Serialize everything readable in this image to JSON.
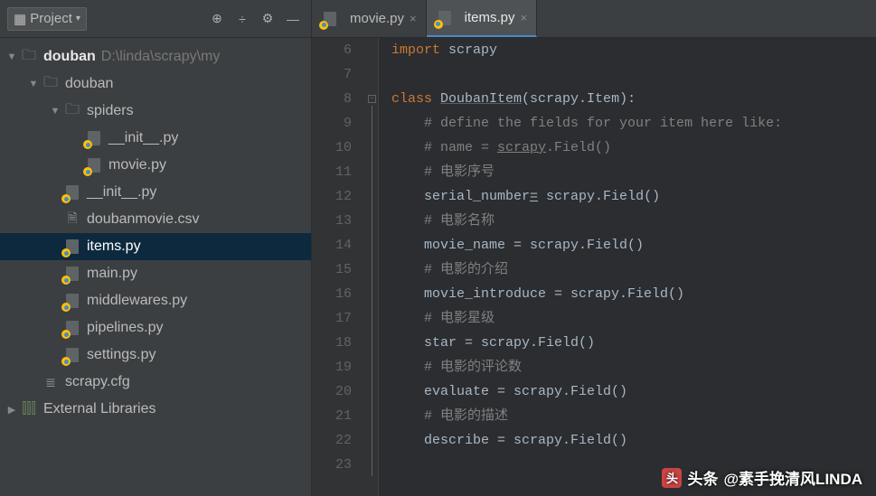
{
  "sidebar": {
    "projectButton": "Project",
    "tree": {
      "root": {
        "name": "douban",
        "path": "D:\\linda\\scrapy\\my"
      },
      "douban": "douban",
      "spiders": "spiders",
      "init1": "__init__.py",
      "movie": "movie.py",
      "init2": "__init__.py",
      "csv": "doubanmovie.csv",
      "items": "items.py",
      "main": "main.py",
      "middlewares": "middlewares.py",
      "pipelines": "pipelines.py",
      "settings": "settings.py",
      "cfg": "scrapy.cfg",
      "ext": "External Libraries"
    }
  },
  "tabs": [
    {
      "label": "movie.py",
      "active": false
    },
    {
      "label": "items.py",
      "active": true
    }
  ],
  "editor": {
    "startLine": 6,
    "lines": [
      {
        "n": 6,
        "html": "<span class='kw'>import</span> scrapy"
      },
      {
        "n": 7,
        "html": ""
      },
      {
        "n": 8,
        "html": "<span class='kw'>class</span> <span class='cls'>DoubanItem</span>(scrapy.Item):"
      },
      {
        "n": 9,
        "html": "    <span class='cmt'># define the fields for your item here like:</span>"
      },
      {
        "n": 10,
        "html": "    <span class='cmt'># name = <u>scrapy</u>.Field()</span>"
      },
      {
        "n": 11,
        "html": "    <span class='cmt'># 电影序号</span>"
      },
      {
        "n": 12,
        "html": "    serial_number<u>=</u> scrapy.Field()"
      },
      {
        "n": 13,
        "html": "    <span class='cmt'># 电影名称</span>"
      },
      {
        "n": 14,
        "html": "    movie_name = scrapy.Field()"
      },
      {
        "n": 15,
        "html": "    <span class='cmt'># 电影的介绍</span>"
      },
      {
        "n": 16,
        "html": "    movie_introduce = scrapy.Field()"
      },
      {
        "n": 17,
        "html": "    <span class='cmt'># 电影星级</span>"
      },
      {
        "n": 18,
        "html": "    star = scrapy.Field()"
      },
      {
        "n": 19,
        "html": "    <span class='cmt'># 电影的评论数</span>"
      },
      {
        "n": 20,
        "html": "    evaluate = scrapy.Field()"
      },
      {
        "n": 21,
        "html": "    <span class='cmt'># 电影的描述</span>"
      },
      {
        "n": 22,
        "html": "    describe = scrapy.Field()"
      },
      {
        "n": 23,
        "html": ""
      }
    ]
  },
  "watermark": {
    "prefix": "头条",
    "at": "@素手挽清风LINDA"
  }
}
